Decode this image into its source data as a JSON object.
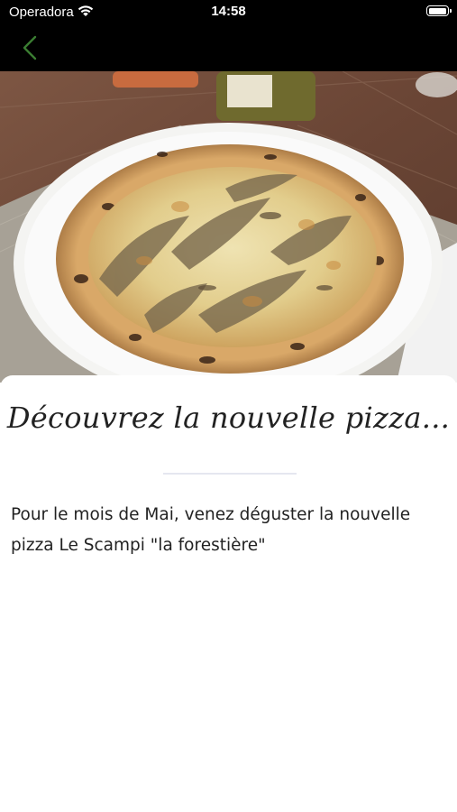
{
  "status_bar": {
    "carrier": "Operadora",
    "time": "14:58",
    "battery_level": 0.95
  },
  "nav": {
    "back_icon": "chevron-left-icon",
    "accent_color": "#3a7d32"
  },
  "hero": {
    "subject": "pizza photo"
  },
  "content": {
    "headline": "Découvrez la nouvelle pizza...",
    "body": "Pour le mois de Mai, venez déguster la nouvelle pizza Le Scampi \"la forestière\""
  }
}
